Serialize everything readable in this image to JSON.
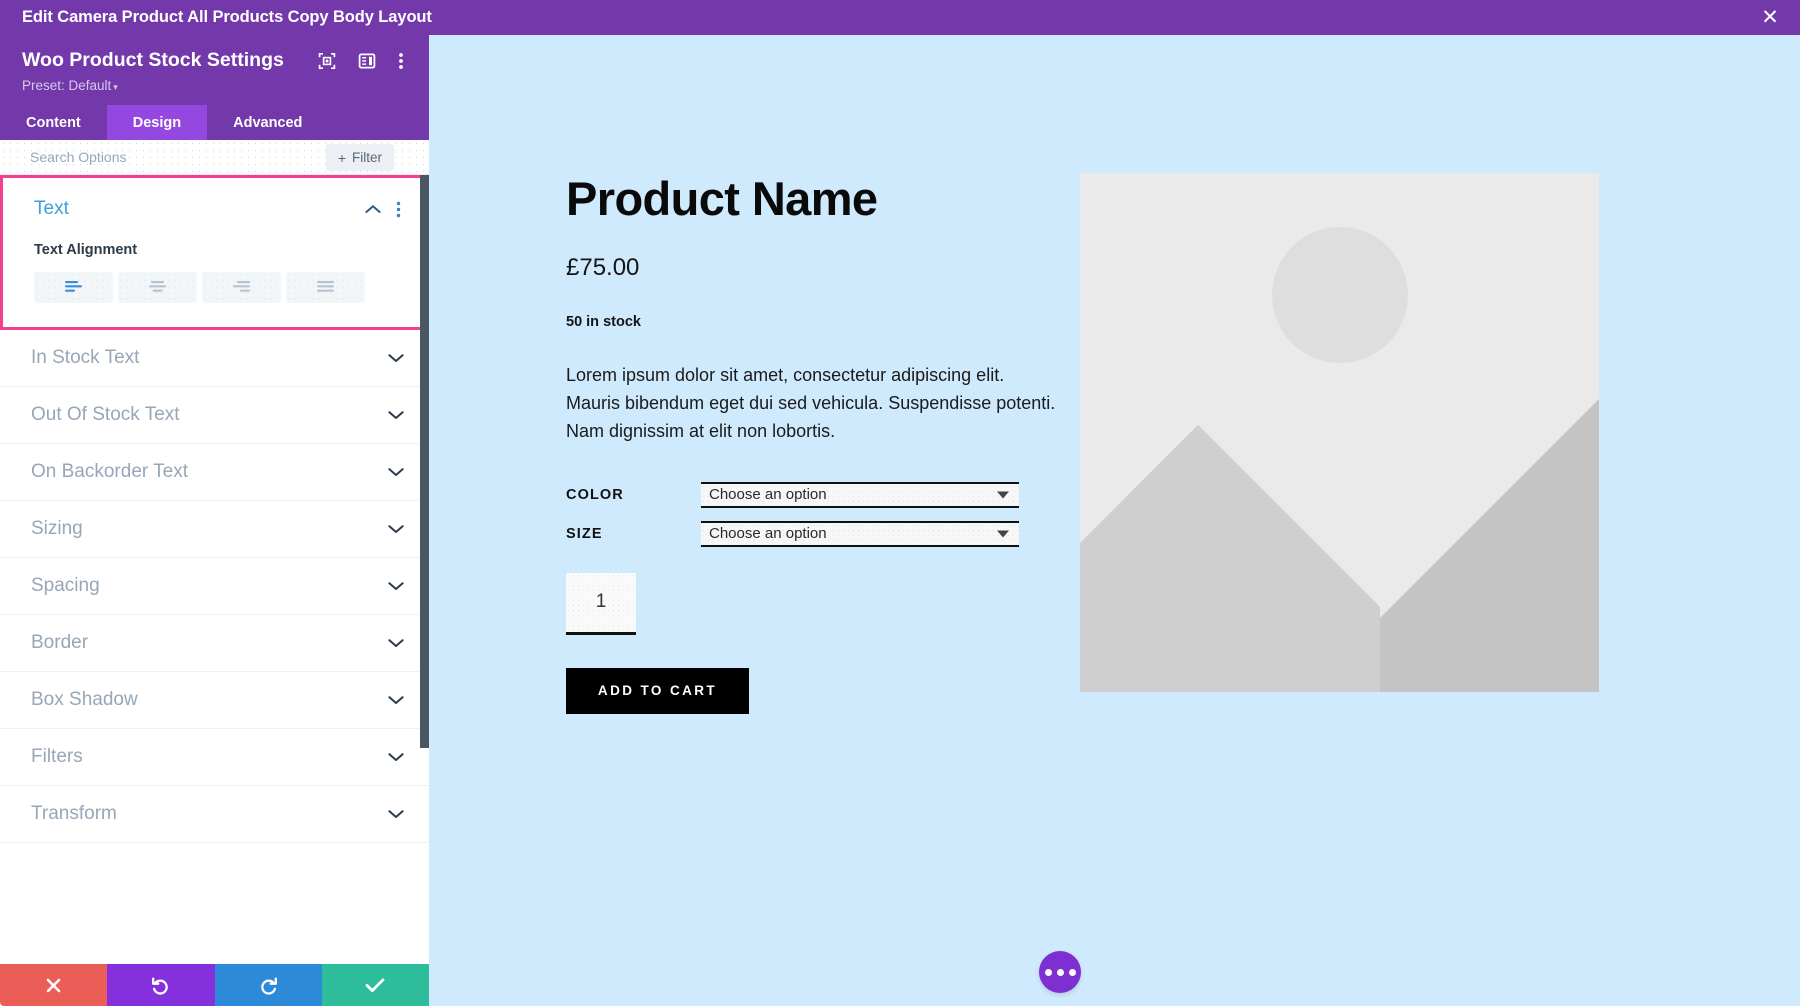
{
  "window": {
    "title": "Edit Camera Product All Products Copy Body Layout",
    "close_icon": "close-icon"
  },
  "panel": {
    "title": "Woo Product Stock Settings",
    "preset": "Preset: Default",
    "preset_caret": "▾",
    "header_icons": [
      "focus-target-icon",
      "layout-panel-icon",
      "more-vertical-icon"
    ],
    "tabs": [
      {
        "label": "Content",
        "active": false
      },
      {
        "label": "Design",
        "active": true
      },
      {
        "label": "Advanced",
        "active": false
      }
    ],
    "search": {
      "placeholder": "Search Options",
      "value": ""
    },
    "filter": {
      "label": "Filter",
      "plus": "+"
    },
    "open_section": {
      "title": "Text",
      "collapse_icon": "chevron-up-icon",
      "menu_icon": "more-vertical-icon",
      "field_label": "Text Alignment",
      "alignment_options": [
        {
          "name": "align-left",
          "active": true
        },
        {
          "name": "align-center",
          "active": false
        },
        {
          "name": "align-right",
          "active": false
        },
        {
          "name": "align-justify",
          "active": false
        }
      ]
    },
    "sections": [
      {
        "label": "In Stock Text"
      },
      {
        "label": "Out Of Stock Text"
      },
      {
        "label": "On Backorder Text"
      },
      {
        "label": "Sizing"
      },
      {
        "label": "Spacing"
      },
      {
        "label": "Border"
      },
      {
        "label": "Box Shadow"
      },
      {
        "label": "Filters"
      },
      {
        "label": "Transform"
      }
    ],
    "actions": [
      {
        "name": "cancel",
        "icon": "close-icon",
        "color": "#eb5d57"
      },
      {
        "name": "undo",
        "icon": "undo-icon",
        "color": "#8430dc"
      },
      {
        "name": "redo",
        "icon": "redo-icon",
        "color": "#2c8ad8"
      },
      {
        "name": "save",
        "icon": "check-icon",
        "color": "#2dbd9a"
      }
    ]
  },
  "canvas": {
    "product": {
      "name": "Product Name",
      "price": "£75.00",
      "stock": "50 in stock",
      "description": "Lorem ipsum dolor sit amet, consectetur adipiscing elit. Mauris bibendum eget dui sed vehicula. Suspendisse potenti. Nam dignissim at elit non lobortis.",
      "attributes": [
        {
          "label": "COLOR",
          "value": "Choose an option"
        },
        {
          "label": "SIZE",
          "value": "Choose an option"
        }
      ],
      "quantity": "1",
      "add_to_cart": "ADD TO CART",
      "image_placeholder": "image-placeholder-icon"
    },
    "fab": "more-horizontal-icon"
  },
  "colors": {
    "brand_purple": "#7339ab",
    "tab_active": "#9448e0",
    "highlight_pink": "#f5408f",
    "section_open_blue": "#3e9ede",
    "section_muted": "#97a6b8",
    "canvas_bg": "#cfe9fd"
  }
}
